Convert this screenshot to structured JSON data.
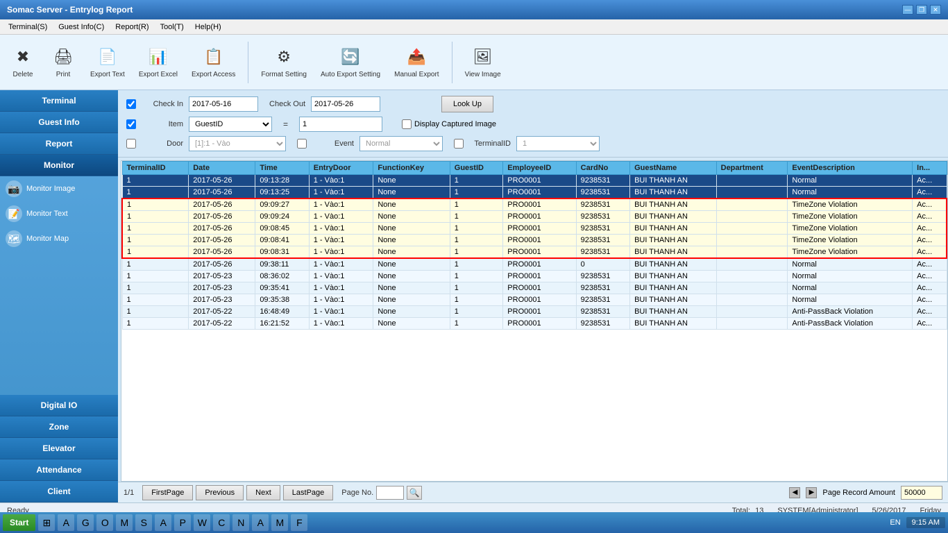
{
  "window": {
    "title": "Somac Server - Entrylog Report",
    "minimize": "—",
    "restore": "❐",
    "close": "✕"
  },
  "menu": {
    "items": [
      "Terminal(S)",
      "Guest Info(C)",
      "Report(R)",
      "Tool(T)",
      "Help(H)"
    ]
  },
  "toolbar": {
    "buttons": [
      {
        "id": "delete",
        "label": "Delete",
        "icon": "✖"
      },
      {
        "id": "print",
        "label": "Print",
        "icon": "🖨"
      },
      {
        "id": "export-text",
        "label": "Export Text",
        "icon": "📄"
      },
      {
        "id": "export-excel",
        "label": "Export Excel",
        "icon": "📊"
      },
      {
        "id": "export-access",
        "label": "Export Access",
        "icon": "📋"
      },
      {
        "id": "format-setting",
        "label": "Format Setting",
        "icon": "⚙"
      },
      {
        "id": "auto-export",
        "label": "Auto Export Setting",
        "icon": "🔄"
      },
      {
        "id": "manual-export",
        "label": "Manual Export",
        "icon": "📤"
      },
      {
        "id": "view-image",
        "label": "View Image",
        "icon": "🖼"
      }
    ]
  },
  "sidebar": {
    "main_buttons": [
      "Terminal",
      "Guest Info",
      "Report",
      "Monitor"
    ],
    "nav_items": [
      {
        "label": "Monitor Image",
        "icon": "📷"
      },
      {
        "label": "Monitor Text",
        "icon": "📝"
      },
      {
        "label": "Monitor Map",
        "icon": "🗺"
      }
    ],
    "bottom_buttons": [
      "Digital IO",
      "Zone",
      "Elevator",
      "Attendance",
      "Client"
    ]
  },
  "filter": {
    "checkin_label": "Check In",
    "checkin_value": "2017-05-16",
    "checkout_label": "Check Out",
    "checkout_value": "2017-05-26",
    "item_label": "Item",
    "item_value": "GuestID",
    "equals_label": "=",
    "value_input": "1",
    "door_label": "Door",
    "door_value": "[1]:1 - Vào",
    "event_label": "Event",
    "event_value": "Normal",
    "terminalid_label": "TerminalID",
    "terminalid_value": "1",
    "lookup_btn": "Look Up",
    "display_capture_label": "Display Captured Image",
    "check1_checked": true,
    "check2_checked": false,
    "check3_checked": false,
    "check4_checked": false
  },
  "table": {
    "columns": [
      "TerminalID",
      "Date",
      "Time",
      "EntryDoor",
      "FunctionKey",
      "GuestID",
      "EmployeeID",
      "CardNo",
      "GuestName",
      "Department",
      "EventDescription",
      "In..."
    ],
    "rows": [
      {
        "id": 0,
        "selected": true,
        "cells": [
          "1",
          "2017-05-26",
          "09:13:28",
          "1 - Vào:1",
          "None",
          "1",
          "PRO0001",
          "9238531",
          "BUI THANH AN",
          "",
          "Normal",
          "Ac..."
        ]
      },
      {
        "id": 1,
        "selected": true,
        "cells": [
          "1",
          "2017-05-26",
          "09:13:25",
          "1 - Vào:1",
          "None",
          "1",
          "PRO0001",
          "9238531",
          "BUI THANH AN",
          "",
          "Normal",
          "Ac..."
        ]
      },
      {
        "id": 2,
        "violation": true,
        "cells": [
          "1",
          "2017-05-26",
          "09:09:27",
          "1 - Vào:1",
          "None",
          "1",
          "PRO0001",
          "9238531",
          "BUI THANH AN",
          "",
          "TimeZone Violation",
          "Ac..."
        ]
      },
      {
        "id": 3,
        "violation": true,
        "cells": [
          "1",
          "2017-05-26",
          "09:09:24",
          "1 - Vào:1",
          "None",
          "1",
          "PRO0001",
          "9238531",
          "BUI THANH AN",
          "",
          "TimeZone Violation",
          "Ac..."
        ]
      },
      {
        "id": 4,
        "violation": true,
        "cells": [
          "1",
          "2017-05-26",
          "09:08:45",
          "1 - Vào:1",
          "None",
          "1",
          "PRO0001",
          "9238531",
          "BUI THANH AN",
          "",
          "TimeZone Violation",
          "Ac..."
        ]
      },
      {
        "id": 5,
        "violation": true,
        "cells": [
          "1",
          "2017-05-26",
          "09:08:41",
          "1 - Vào:1",
          "None",
          "1",
          "PRO0001",
          "9238531",
          "BUI THANH AN",
          "",
          "TimeZone Violation",
          "Ac..."
        ]
      },
      {
        "id": 6,
        "violation": true,
        "cells": [
          "1",
          "2017-05-26",
          "09:08:31",
          "1 - Vào:1",
          "None",
          "1",
          "PRO0001",
          "9238531",
          "BUI THANH AN",
          "",
          "TimeZone Violation",
          "Ac..."
        ]
      },
      {
        "id": 7,
        "cells": [
          "1",
          "2017-05-26",
          "09:38:11",
          "1 - Vào:1",
          "None",
          "1",
          "PRO0001",
          "0",
          "BUI THANH AN",
          "",
          "Normal",
          "Ac..."
        ]
      },
      {
        "id": 8,
        "cells": [
          "1",
          "2017-05-23",
          "08:36:02",
          "1 - Vào:1",
          "None",
          "1",
          "PRO0001",
          "9238531",
          "BUI THANH AN",
          "",
          "Normal",
          "Ac..."
        ]
      },
      {
        "id": 9,
        "cells": [
          "1",
          "2017-05-23",
          "09:35:41",
          "1 - Vào:1",
          "None",
          "1",
          "PRO0001",
          "9238531",
          "BUI THANH AN",
          "",
          "Normal",
          "Ac..."
        ]
      },
      {
        "id": 10,
        "cells": [
          "1",
          "2017-05-23",
          "09:35:38",
          "1 - Vào:1",
          "None",
          "1",
          "PRO0001",
          "9238531",
          "BUI THANH AN",
          "",
          "Normal",
          "Ac..."
        ]
      },
      {
        "id": 11,
        "cells": [
          "1",
          "2017-05-22",
          "16:48:49",
          "1 - Vào:1",
          "None",
          "1",
          "PRO0001",
          "9238531",
          "BUI THANH AN",
          "",
          "Anti-PassBack Violation",
          "Ac..."
        ]
      },
      {
        "id": 12,
        "cells": [
          "1",
          "2017-05-22",
          "16:21:52",
          "1 - Vào:1",
          "None",
          "1",
          "PRO0001",
          "9238531",
          "BUI THANH AN",
          "",
          "Anti-PassBack Violation",
          "Ac..."
        ]
      }
    ]
  },
  "pagination": {
    "current_page": "1/1",
    "first_page": "FirstPage",
    "previous": "Previous",
    "next": "Next",
    "last_page": "LastPage",
    "page_no_label": "Page No.",
    "page_no_value": "",
    "search_icon": "🔍",
    "page_record_label": "Page Record Amount",
    "page_record_value": "50000",
    "scroll_left": "◀",
    "scroll_right": "▶"
  },
  "status": {
    "ready": "Ready",
    "total_label": "Total:",
    "total_value": "13",
    "user": "SYSTEM[Administrator]",
    "date": "5/26/2017",
    "day": "Friday"
  },
  "taskbar": {
    "start": "Start",
    "icons": [
      "⊞",
      "A",
      "G",
      "O",
      "M",
      "S",
      "A",
      "P",
      "W",
      "C",
      "N",
      "A",
      "M",
      "F"
    ],
    "lang": "EN",
    "time": "9:15 AM"
  }
}
